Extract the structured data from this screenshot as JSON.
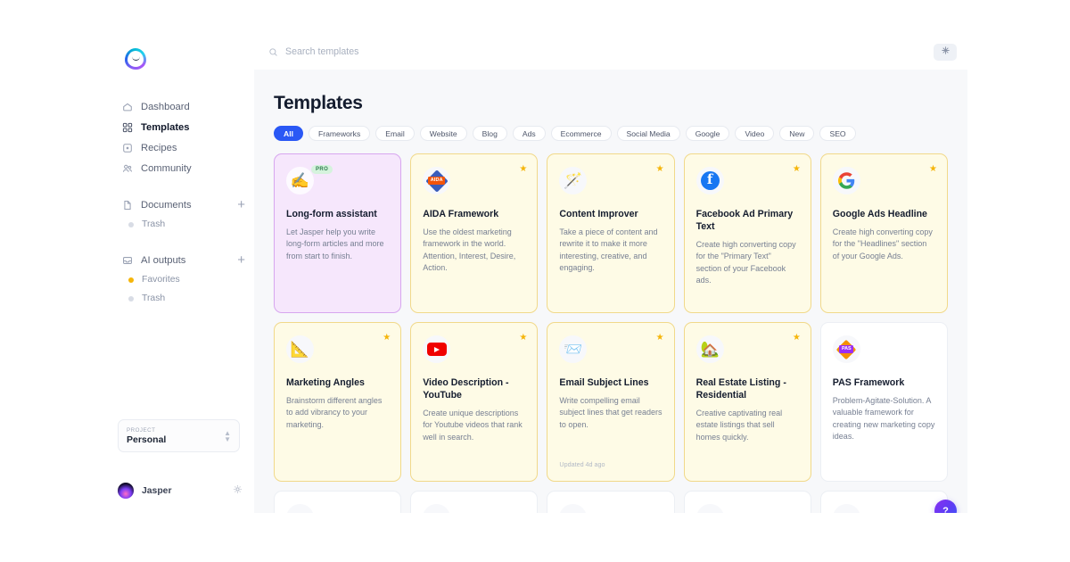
{
  "app": {
    "logo_name": "jasper-logo"
  },
  "sidebar": {
    "nav": [
      {
        "label": "Dashboard",
        "icon": "home-icon",
        "active": false
      },
      {
        "label": "Templates",
        "icon": "grid-icon",
        "active": true
      },
      {
        "label": "Recipes",
        "icon": "recipe-icon",
        "active": false
      },
      {
        "label": "Community",
        "icon": "people-icon",
        "active": false
      }
    ],
    "documents": {
      "label": "Documents",
      "icon": "document-icon",
      "add_label": "+"
    },
    "documents_sub": [
      {
        "label": "Trash",
        "dot": "gray"
      }
    ],
    "ai_outputs": {
      "label": "AI outputs",
      "icon": "inbox-icon",
      "add_label": "+"
    },
    "ai_outputs_sub": [
      {
        "label": "Favorites",
        "dot": "yellow"
      },
      {
        "label": "Trash",
        "dot": "gray"
      }
    ],
    "project": {
      "label": "PROJECT",
      "value": "Personal"
    },
    "user": {
      "name": "Jasper",
      "settings_icon": "gear-icon"
    }
  },
  "topbar": {
    "search_placeholder": "Search templates",
    "search_value": "",
    "search_icon": "search-icon",
    "action_icon": "sparkle-icon"
  },
  "page": {
    "title": "Templates",
    "chips": [
      {
        "label": "All",
        "active": true
      },
      {
        "label": "Frameworks",
        "active": false
      },
      {
        "label": "Email",
        "active": false
      },
      {
        "label": "Website",
        "active": false
      },
      {
        "label": "Blog",
        "active": false
      },
      {
        "label": "Ads",
        "active": false
      },
      {
        "label": "Ecommerce",
        "active": false
      },
      {
        "label": "Social Media",
        "active": false
      },
      {
        "label": "Google",
        "active": false
      },
      {
        "label": "Video",
        "active": false
      },
      {
        "label": "New",
        "active": false
      },
      {
        "label": "SEO",
        "active": false
      }
    ],
    "help_button": "?"
  },
  "cards": [
    {
      "title": "Long-form assistant",
      "desc": "Let Jasper help you write long-form articles and more from start to finish.",
      "icon": "writing-hand-icon",
      "glyph": "✍️",
      "variant": "pro",
      "badge": "PRO",
      "starred": false,
      "meta": ""
    },
    {
      "title": "AIDA Framework",
      "desc": "Use the oldest marketing framework in the world. Attention, Interest, Desire, Action.",
      "icon": "aida-badge-icon",
      "glyph": "",
      "variant": "yellow",
      "badge": "",
      "starred": true,
      "meta": ""
    },
    {
      "title": "Content Improver",
      "desc": "Take a piece of content and rewrite it to make it more interesting, creative, and engaging.",
      "icon": "magic-wand-icon",
      "glyph": "🪄",
      "variant": "yellow",
      "badge": "",
      "starred": true,
      "meta": ""
    },
    {
      "title": "Facebook Ad Primary Text",
      "desc": "Create high converting copy for the \"Primary Text\" section of your Facebook ads.",
      "icon": "facebook-icon",
      "glyph": "",
      "variant": "yellow",
      "badge": "",
      "starred": true,
      "meta": ""
    },
    {
      "title": "Google Ads Headline",
      "desc": "Create high converting copy for the \"Headlines\" section of your Google Ads.",
      "icon": "google-icon",
      "glyph": "",
      "variant": "yellow",
      "badge": "",
      "starred": true,
      "meta": ""
    },
    {
      "title": "Marketing Angles",
      "desc": "Brainstorm different angles to add vibrancy to your marketing.",
      "icon": "triangle-ruler-icon",
      "glyph": "📐",
      "variant": "yellow",
      "badge": "",
      "starred": true,
      "meta": ""
    },
    {
      "title": "Video Description - YouTube",
      "desc": "Create unique descriptions for Youtube videos that rank well in search.",
      "icon": "youtube-icon",
      "glyph": "",
      "variant": "yellow",
      "badge": "",
      "starred": true,
      "meta": ""
    },
    {
      "title": "Email Subject Lines",
      "desc": "Write compelling email subject lines that get readers to open.",
      "icon": "incoming-envelope-icon",
      "glyph": "📨",
      "variant": "yellow",
      "badge": "",
      "starred": true,
      "meta": "Updated 4d ago"
    },
    {
      "title": "Real Estate Listing - Residential",
      "desc": "Creative captivating real estate listings that sell homes quickly.",
      "icon": "house-with-garden-icon",
      "glyph": "🏡",
      "variant": "yellow",
      "badge": "",
      "starred": true,
      "meta": ""
    },
    {
      "title": "PAS Framework",
      "desc": "Problem-Agitate-Solution. A valuable framework for creating new marketing copy ideas.",
      "icon": "pas-badge-icon",
      "glyph": "",
      "variant": "plain",
      "badge": "",
      "starred": false,
      "meta": ""
    }
  ]
}
